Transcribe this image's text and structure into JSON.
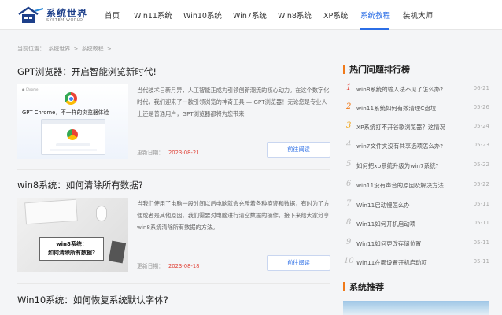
{
  "logo": {
    "name": "系统世界",
    "sub": "SYSTEM WORLD"
  },
  "nav": [
    "首页",
    "Win11系统",
    "Win10系统",
    "Win7系统",
    "Win8系统",
    "XP系统",
    "系统教程",
    "装机大师"
  ],
  "nav_active": "系统教程",
  "breadcrumb": [
    "当前位置：",
    "系统世界",
    ">",
    "系统教程",
    ">"
  ],
  "articles": [
    {
      "title": "GPT浏览器：开启智能浏览新时代!",
      "excerpt": "当代技术日新月异，人工智能正成为引领创新潮流的核心动力。在这个数字化时代，我们迎来了一款引领浏览的神奇工具 — GPT浏览器！无论您是专业人士还是普通用户，GPT浏览器都将为您带来",
      "date_label": "更新日期：",
      "date": "2023-08-21",
      "button": "前往阅读",
      "thumb_text": "GPT Chrome，不一样的浏览器体验"
    },
    {
      "title": "win8系统：如何清除所有数据?",
      "excerpt": "当我们使用了电脑一段时间以后电脑就会充斥着各种痕迹和数据，有时为了方便或者是其他原因，我们需要对电脑进行清空数据的操作，接下来给大家分享win8系统清除所有数据的方法。",
      "date_label": "更新日期：",
      "date": "2023-08-18",
      "button": "前往阅读",
      "thumb_text": "win8系统：\n如何清除所有数据?"
    },
    {
      "title": "Win10系统：如何恢复系统默认字体?"
    }
  ],
  "sidebar": {
    "hot_title": "热门问题排行榜",
    "hot_items": [
      {
        "num": "1",
        "text": "win8系统的输入法不见了怎么办?",
        "date": "06-21"
      },
      {
        "num": "2",
        "text": "win11系统如何有效清理C盘垃",
        "date": "05-26"
      },
      {
        "num": "3",
        "text": "XP系统打不开谷歌浏览器？这情况",
        "date": "05-24"
      },
      {
        "num": "4",
        "text": "win7文件夹没有共享选项怎么办?",
        "date": "05-23"
      },
      {
        "num": "5",
        "text": "如何把xp系统升级为win7系统?",
        "date": "05-22"
      },
      {
        "num": "6",
        "text": "win11没有声音的原因及解决方法",
        "date": "05-22"
      },
      {
        "num": "7",
        "text": "Win11启动慢怎么办",
        "date": "05-11"
      },
      {
        "num": "8",
        "text": "Win11如何开机启动项",
        "date": "05-11"
      },
      {
        "num": "9",
        "text": "Win11如何更改存储位置",
        "date": "05-11"
      },
      {
        "num": "10",
        "text": "Win11在哪设置开机启动项",
        "date": "05-11"
      }
    ],
    "recommend_title": "系统推荐"
  }
}
